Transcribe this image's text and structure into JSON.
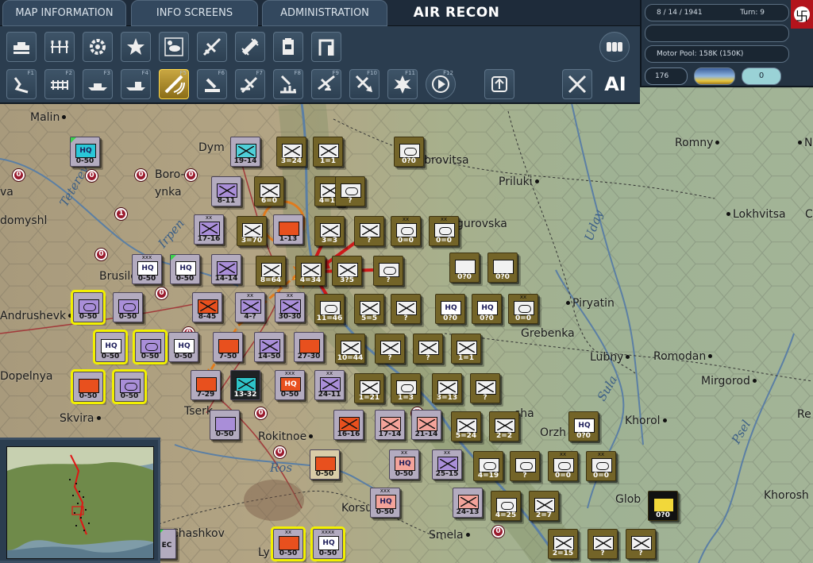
{
  "tabs": {
    "map_information": "MAP INFORMATION",
    "info_screens": "INFO SCREENS",
    "administration": "ADMINISTRATION",
    "current_view": "AIR RECON"
  },
  "info_panel": {
    "date": "8 / 14 / 1941",
    "turn": "Turn: 9",
    "motor_pool": "Motor Pool:  158K (150K)",
    "count": "176",
    "toggle_value": "0"
  },
  "toolbar": {
    "top_row": [
      "ground-units-icon",
      "formation-icon",
      "gear-icon",
      "star-icon",
      "weather-icon",
      "air-units-icon",
      "rail-icon",
      "supply-icon",
      "depot-icon",
      "stack-icon"
    ],
    "bottom_row": [
      {
        "icon": "movement-icon",
        "key": "F1"
      },
      {
        "icon": "rail-movement-icon",
        "key": "F2"
      },
      {
        "icon": "naval-icon",
        "key": "F3"
      },
      {
        "icon": "sea-transport-icon",
        "key": "F4"
      },
      {
        "icon": "air-recon-icon",
        "key": "F5"
      },
      {
        "icon": "artillery-icon",
        "key": "F6"
      },
      {
        "icon": "air-transport-icon",
        "key": "F7"
      },
      {
        "icon": "bombing-icon",
        "key": "F8"
      },
      {
        "icon": "paradrop-icon",
        "key": "F9"
      },
      {
        "icon": "air-strike-icon",
        "key": "F10"
      },
      {
        "icon": "explosion-icon",
        "key": "F11"
      },
      {
        "icon": "next-icon",
        "key": "F12"
      }
    ],
    "ai_label": "AI"
  },
  "towns": [
    {
      "name": "Malin",
      "dot": "left"
    },
    {
      "name": "Dym",
      "dot": "none"
    },
    {
      "name": "Bobrovitsa",
      "dot": "left"
    },
    {
      "name": "Priluki",
      "dot": "right"
    },
    {
      "name": "Romny",
      "dot": "right"
    },
    {
      "name": "N",
      "dot": "left"
    },
    {
      "name": "Boro-",
      "dot": "none"
    },
    {
      "name": "ynka",
      "dot": "none"
    },
    {
      "name": "va",
      "dot": "none"
    },
    {
      "name": "domyshl",
      "dot": "none"
    },
    {
      "name": "gurovska",
      "dot": "none"
    },
    {
      "name": "Lokhvitsa",
      "dot": "left"
    },
    {
      "name": "C",
      "dot": "none"
    },
    {
      "name": "Brusilo",
      "dot": "none"
    },
    {
      "name": "Andrushevk",
      "dot": "left"
    },
    {
      "name": "Piryatin",
      "dot": "left"
    },
    {
      "name": "Grebenka",
      "dot": "none"
    },
    {
      "name": "Lubny",
      "dot": "right"
    },
    {
      "name": "Romodan",
      "dot": "right"
    },
    {
      "name": "Mirgorod",
      "dot": "right"
    },
    {
      "name": "Dopelnya",
      "dot": "none"
    },
    {
      "name": "Skvira",
      "dot": "right"
    },
    {
      "name": "Tserk",
      "dot": "none"
    },
    {
      "name": "Rokitnoe",
      "dot": "right"
    },
    {
      "name": "Orzh",
      "dot": "none"
    },
    {
      "name": "Khorol",
      "dot": "right"
    },
    {
      "name": "Re",
      "dot": "none"
    },
    {
      "name": "Glob",
      "dot": "none"
    },
    {
      "name": "Khorosh",
      "dot": "none"
    },
    {
      "name": "Korsu",
      "dot": "none"
    },
    {
      "name": "Smela",
      "dot": "right"
    },
    {
      "name": "Chashkov",
      "dot": "none"
    },
    {
      "name": "Ly",
      "dot": "none"
    },
    {
      "name": "sha",
      "dot": "none"
    }
  ],
  "rivers": [
    "Teterev",
    "Irpen",
    "Uday",
    "Sula",
    "Psel",
    "Ros"
  ],
  "units_german": [
    {
      "label": "3=24",
      "z": "3"
    },
    {
      "label": "1=1",
      "z": "0"
    },
    {
      "label": "0?0",
      "z": "1"
    },
    {
      "label": "6=0",
      "z": "3"
    },
    {
      "label": "4=18",
      "z": "2"
    },
    {
      "label": "?",
      "z": "0"
    },
    {
      "label": "3=70",
      "z": "1"
    },
    {
      "label": "3=3",
      "z": "0"
    },
    {
      "label": "?",
      "z": "0"
    },
    {
      "label": "0=0",
      "z": "0"
    },
    {
      "label": "0=0",
      "z": "0"
    },
    {
      "label": "8=64",
      "z": "3"
    },
    {
      "label": "4=34",
      "z": "1"
    },
    {
      "label": "3?5",
      "z": "1"
    },
    {
      "label": "?",
      "z": "0"
    },
    {
      "label": "0?0",
      "z": "0"
    },
    {
      "label": "0?0",
      "z": "0"
    },
    {
      "label": "11=46",
      "z": "1"
    },
    {
      "label": "5=5",
      "z": "1"
    },
    {
      "label": "?",
      "z": "0"
    },
    {
      "label": "0?0",
      "z": "1"
    },
    {
      "label": "0?0",
      "z": "0"
    },
    {
      "label": "0=0",
      "z": "0"
    },
    {
      "label": "10=44",
      "z": "1"
    },
    {
      "label": "?",
      "z": "2"
    },
    {
      "label": "?",
      "z": "1"
    },
    {
      "label": "1=1",
      "z": "1"
    },
    {
      "label": "1=21",
      "z": "1"
    },
    {
      "label": "1=3",
      "z": "2"
    },
    {
      "label": "3=13",
      "z": "3"
    },
    {
      "label": "?",
      "z": "1"
    },
    {
      "label": "5=24",
      "z": "3"
    },
    {
      "label": "2=2",
      "z": "1"
    },
    {
      "label": "0?0",
      "z": "0"
    },
    {
      "label": "4=19",
      "z": "3"
    },
    {
      "label": "?",
      "z": "0"
    },
    {
      "label": "0=0",
      "z": "0"
    },
    {
      "label": "0=0",
      "z": "0"
    },
    {
      "label": "4=25",
      "z": "3"
    },
    {
      "label": "2=7",
      "z": "2"
    },
    {
      "label": "0?0",
      "z": "0"
    },
    {
      "label": "2=15",
      "z": "3"
    },
    {
      "label": "?",
      "z": "3"
    },
    {
      "label": "?",
      "z": "2"
    }
  ],
  "units_soviet": [
    {
      "label": "0-50",
      "z": "0"
    },
    {
      "label": "19-14",
      "z": "0"
    },
    {
      "label": "8-11",
      "z": "2"
    },
    {
      "label": "17-16",
      "z": "1"
    },
    {
      "label": "1-13",
      "z": "0"
    },
    {
      "label": "0-50",
      "z": "0"
    },
    {
      "label": "0-50",
      "z": "0"
    },
    {
      "label": "14-14",
      "z": "2"
    },
    {
      "label": "0-50",
      "z": "0"
    },
    {
      "label": "0-50",
      "z": "0"
    },
    {
      "label": "8-45",
      "z": "0"
    },
    {
      "label": "4-?",
      "z": "2"
    },
    {
      "label": "30-30",
      "z": "1"
    },
    {
      "label": "0-50",
      "z": "0"
    },
    {
      "label": "0-50",
      "z": "0"
    },
    {
      "label": "0-50",
      "z": "0"
    },
    {
      "label": "7-50",
      "z": "0"
    },
    {
      "label": "14-50",
      "z": "1"
    },
    {
      "label": "27-30",
      "z": "1"
    },
    {
      "label": "0-50",
      "z": "0"
    },
    {
      "label": "0-50",
      "z": "0"
    },
    {
      "label": "7-29",
      "z": "0"
    },
    {
      "label": "13-32",
      "z": "0"
    },
    {
      "label": "0-50",
      "z": "0"
    },
    {
      "label": "24-11",
      "z": "0"
    },
    {
      "label": "0-50",
      "z": "1"
    },
    {
      "label": "16-16",
      "z": "2"
    },
    {
      "label": "17-14",
      "z": "0"
    },
    {
      "label": "21-14",
      "z": "0"
    },
    {
      "label": "0-50",
      "z": "0"
    },
    {
      "label": "0-50",
      "z": "0"
    },
    {
      "label": "25-15",
      "z": "0"
    },
    {
      "label": "0-50",
      "z": "1"
    },
    {
      "label": "24-13",
      "z": "0"
    },
    {
      "label": "0-50",
      "z": "0"
    },
    {
      "label": "0-50",
      "z": "0"
    },
    {
      "label": "EC",
      "z": "0"
    }
  ],
  "colors": {
    "german": "#736428",
    "soviet": "#b3abbf",
    "selected": "#f2f000",
    "attack": "#cc1a1a",
    "move": "#e07b1e"
  }
}
